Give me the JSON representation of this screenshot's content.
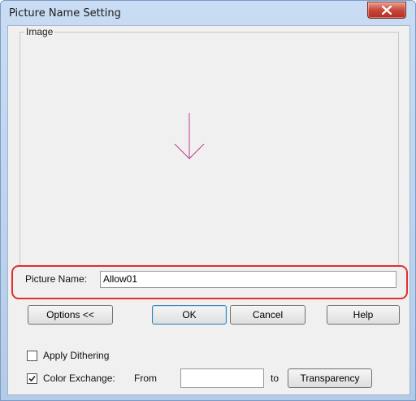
{
  "window": {
    "title": "Picture Name Setting"
  },
  "image_group": {
    "legend": "Image",
    "preview_icon": "down-arrow-icon",
    "preview_color": "#c03d91"
  },
  "picture_name": {
    "label": "Picture Name:",
    "value": "Allow01"
  },
  "buttons": {
    "options": "Options <<",
    "ok": "OK",
    "cancel": "Cancel",
    "help": "Help",
    "transparency": "Transparency"
  },
  "apply_dithering": {
    "label": "Apply Dithering",
    "checked": false
  },
  "color_exchange": {
    "label": "Color Exchange:",
    "checked": true,
    "from_label": "From",
    "from_value": "",
    "to_label": "to"
  },
  "colors": {
    "highlight": "#e03030",
    "titlebar": "#c9dcf3",
    "close_button": "#c9463a"
  }
}
